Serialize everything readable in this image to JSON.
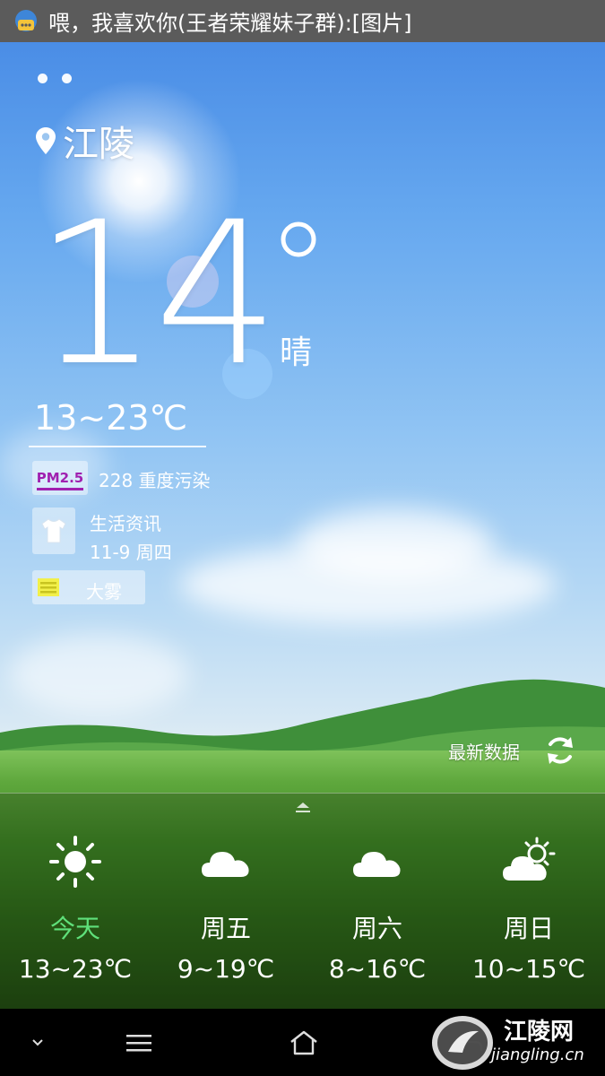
{
  "notification": {
    "text": "喂，我喜欢你(王者荣耀妹子群):[图片]",
    "icon": "chat-bubble-icon"
  },
  "pager": {
    "pages": 2
  },
  "location": {
    "city": "江陵",
    "icon": "location-pin-icon"
  },
  "current": {
    "temperature": "14",
    "condition": "晴",
    "range": "13~23℃"
  },
  "air": {
    "label": "PM2.5",
    "value_text": "228  重度污染",
    "color": "#a020b0"
  },
  "life": {
    "title": "生活资讯",
    "date": "11-9 周四",
    "icon": "shirt-icon"
  },
  "alert": {
    "label": "大雾",
    "icon": "fog-warning-icon",
    "color": "#f2f04a"
  },
  "refresh": {
    "label": "最新数据",
    "icon": "refresh-icon"
  },
  "forecast": [
    {
      "day": "今天",
      "range": "13~23℃",
      "icon": "sunny-icon",
      "highlight": "#5fe07a"
    },
    {
      "day": "周五",
      "range": "9~19℃",
      "icon": "cloudy-icon"
    },
    {
      "day": "周六",
      "range": "8~16℃",
      "icon": "cloudy-icon"
    },
    {
      "day": "周日",
      "range": "10~15℃",
      "icon": "partly-cloudy-icon"
    }
  ],
  "navbar": {
    "icons": [
      "chevron-down-icon",
      "menu-icon",
      "home-icon",
      "back-icon"
    ]
  },
  "watermark": {
    "name": "江陵网",
    "url": "jiangling.cn"
  }
}
